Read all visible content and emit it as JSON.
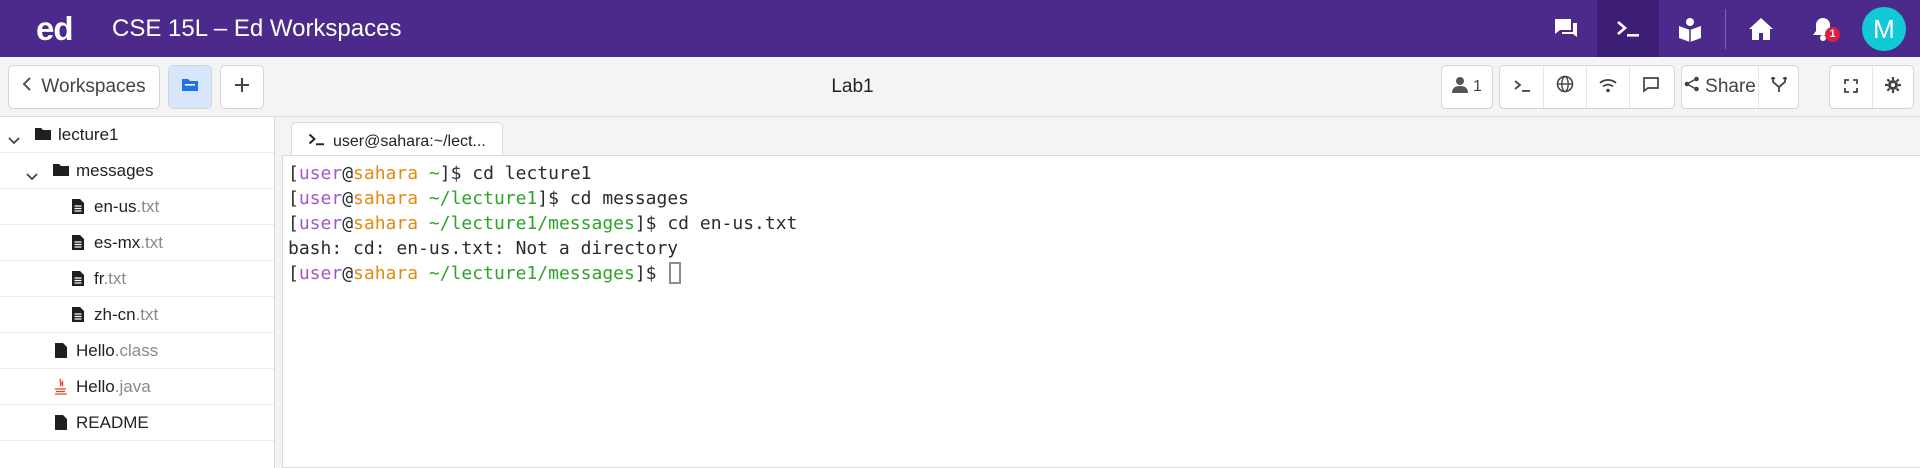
{
  "app": {
    "logo": "ed",
    "title": "CSE 15L – Ed Workspaces",
    "notification_count": "1",
    "avatar_initial": "M"
  },
  "top_icons": [
    "chat-icon",
    "terminal-icon",
    "lessons-icon",
    "home-icon",
    "bell-icon"
  ],
  "toolbar": {
    "back_label": "Workspaces",
    "doc_title": "Lab1",
    "user_count": "1",
    "share_label": "Share"
  },
  "file_tree": [
    {
      "name": "lecture1",
      "ext": "",
      "type": "folder",
      "expanded": true
    },
    {
      "name": "messages",
      "ext": "",
      "type": "folder",
      "expanded": true
    },
    {
      "name": "en-us",
      "ext": ".txt",
      "type": "text-file"
    },
    {
      "name": "es-mx",
      "ext": ".txt",
      "type": "text-file"
    },
    {
      "name": "fr",
      "ext": ".txt",
      "type": "text-file"
    },
    {
      "name": "zh-cn",
      "ext": ".txt",
      "type": "text-file"
    },
    {
      "name": "Hello",
      "ext": ".class",
      "type": "file"
    },
    {
      "name": "Hello",
      "ext": ".java",
      "type": "java-file"
    },
    {
      "name": "README",
      "ext": "",
      "type": "file"
    }
  ],
  "terminal": {
    "tab_label": "user@sahara:~/lect...",
    "lines": [
      {
        "user": "user",
        "host": "sahara",
        "path": "~",
        "cmd": "$ cd lecture1"
      },
      {
        "user": "user",
        "host": "sahara",
        "path": "~/lecture1",
        "cmd": "$ cd messages"
      },
      {
        "user": "user",
        "host": "sahara",
        "path": "~/lecture1/messages",
        "cmd": "$ cd en-us.txt"
      },
      {
        "output": "bash: cd: en-us.txt: Not a directory"
      },
      {
        "user": "user",
        "host": "sahara",
        "path": "~/lecture1/messages",
        "cmd": "$ "
      }
    ]
  },
  "colors": {
    "topbar": "#4b2a8c",
    "avatar": "#12c9d6",
    "prompt_user": "#a258c9",
    "prompt_host": "#e28a12",
    "prompt_path": "#2ea329"
  }
}
